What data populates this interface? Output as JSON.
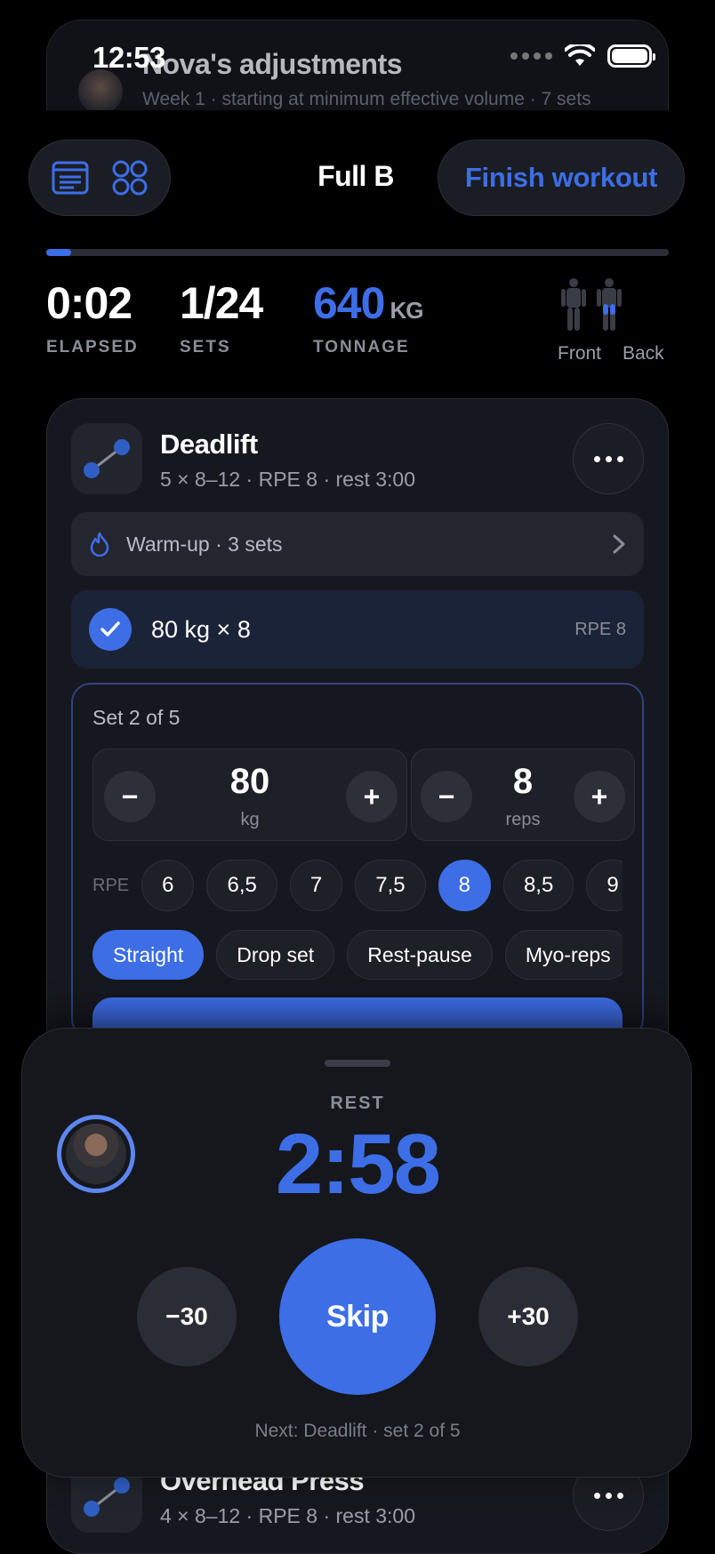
{
  "status_bar": {
    "time": "12:53"
  },
  "coach_banner": {
    "title": "Nova's adjustments",
    "subtitle": "Week 1 · starting at minimum effective volume · 7 sets"
  },
  "toolbar": {
    "workout_title": "Full B",
    "finish_label": "Finish workout"
  },
  "progress": {
    "fraction": 0.04
  },
  "stats": {
    "elapsed_value": "0:02",
    "elapsed_label": "ELAPSED",
    "sets_value": "1/24",
    "sets_label": "SETS",
    "tonnage_value": "640",
    "tonnage_unit": "KG",
    "tonnage_label": "TONNAGE",
    "front_label": "Front",
    "back_label": "Back"
  },
  "exercise": {
    "name": "Deadlift",
    "meta": "5 × 8–12 · RPE 8 · rest 3:00",
    "warmup_label": "Warm-up · 3 sets",
    "completed_set": {
      "text": "80 kg × 8",
      "rpe": "RPE 8"
    },
    "current_set_title": "Set 2 of 5",
    "weight": {
      "value": "80",
      "unit": "kg"
    },
    "reps": {
      "value": "8",
      "unit": "reps"
    },
    "rpe_label": "RPE",
    "rpe_options": [
      "6",
      "6,5",
      "7",
      "7,5",
      "8",
      "8,5",
      "9"
    ],
    "rpe_selected": "8",
    "set_types": [
      "Straight",
      "Drop set",
      "Rest-pause",
      "Myo-reps"
    ],
    "set_type_selected": "Straight"
  },
  "next_exercise": {
    "name": "Overhead Press",
    "meta": "4 × 8–12 · RPE 8 · rest 3:00"
  },
  "rest_timer": {
    "label": "REST",
    "time": "2:58",
    "minus_label": "−30",
    "skip_label": "Skip",
    "plus_label": "+30",
    "next_text": "Next: Deadlift · set 2 of 5"
  },
  "colors": {
    "accent": "#3d6ee6",
    "background": "#000000",
    "card": "#16181f"
  }
}
